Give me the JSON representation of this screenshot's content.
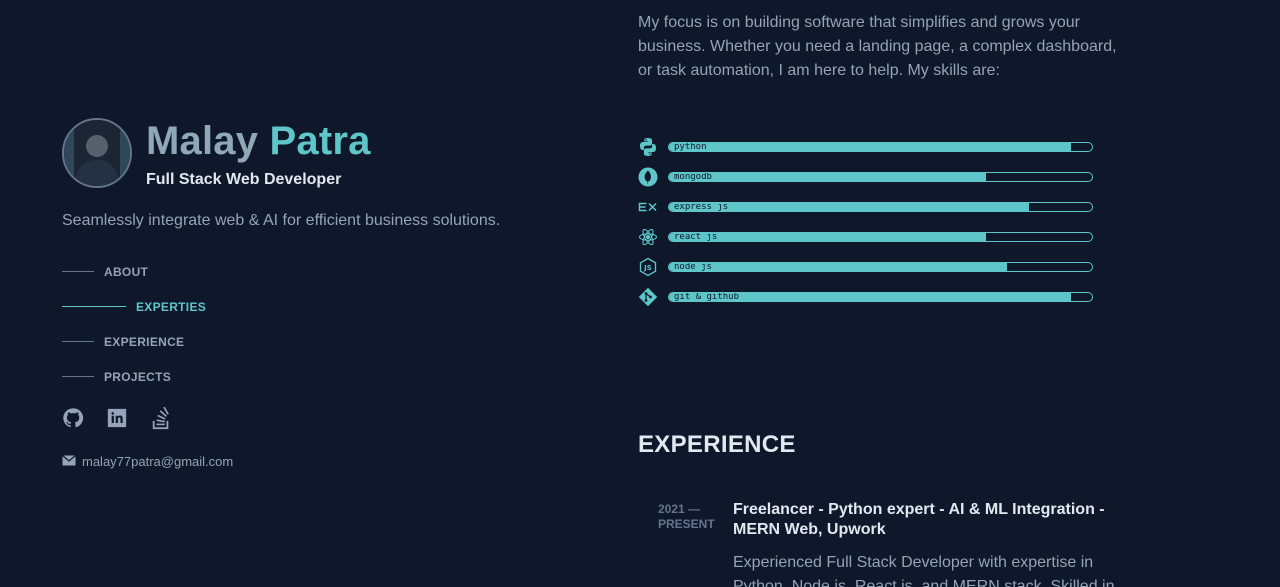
{
  "profile": {
    "name_first": "Malay",
    "name_last": "Patra",
    "role": "Full Stack Web Developer",
    "tagline": "Seamlessly integrate web & AI for efficient business solutions.",
    "email": "malay77patra@gmail.com"
  },
  "nav": [
    {
      "label": "ABOUT",
      "active": false
    },
    {
      "label": "EXPERTIES",
      "active": true
    },
    {
      "label": "EXPERIENCE",
      "active": false
    },
    {
      "label": "PROJECTS",
      "active": false
    }
  ],
  "socials": [
    "github-icon",
    "linkedin-icon",
    "stackoverflow-icon"
  ],
  "intro": "My focus is on building software that simplifies and grows your business. Whether you need a landing page, a complex dashboard, or task automation, I am here to help. My skills are:",
  "skills": [
    {
      "label": "python",
      "icon": "python-icon",
      "level": 0.95
    },
    {
      "label": "mongodb",
      "icon": "mongodb-icon",
      "level": 0.75
    },
    {
      "label": "express js",
      "icon": "express-icon",
      "level": 0.85
    },
    {
      "label": "react js",
      "icon": "react-icon",
      "level": 0.75
    },
    {
      "label": "node js",
      "icon": "nodejs-icon",
      "level": 0.8
    },
    {
      "label": "git & github",
      "icon": "git-icon",
      "level": 0.95
    }
  ],
  "experience": {
    "heading": "EXPERIENCE",
    "items": [
      {
        "period_start": "2021 —",
        "period_end": "PRESENT",
        "title": "Freelancer - Python expert - AI & ML Integration - MERN Web, Upwork",
        "description": "Experienced Full Stack Developer with expertise in Python, Node.js, React.js, and MERN stack. Skilled in"
      }
    ]
  },
  "colors": {
    "background": "#0f172a",
    "accent": "#5ec5c8",
    "muted": "#94a3b8",
    "heading": "#e2e8f0"
  }
}
